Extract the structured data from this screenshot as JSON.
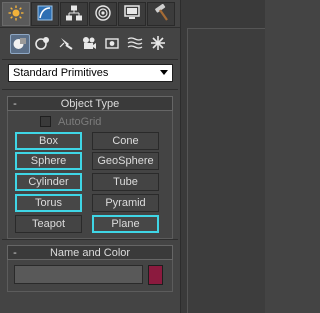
{
  "tabs": [
    {
      "icon": "create-sun-icon",
      "active": true
    },
    {
      "icon": "modify-curve-icon",
      "active": false
    },
    {
      "icon": "hierarchy-icon",
      "active": false
    },
    {
      "icon": "motion-icon",
      "active": false
    },
    {
      "icon": "display-icon",
      "active": false
    },
    {
      "icon": "utilities-hammer-icon",
      "active": false
    }
  ],
  "categories": [
    {
      "icon": "geometry-icon",
      "active": true
    },
    {
      "icon": "shapes-icon",
      "active": false
    },
    {
      "icon": "lights-icon",
      "active": false
    },
    {
      "icon": "cameras-icon",
      "active": false
    },
    {
      "icon": "helpers-icon",
      "active": false
    },
    {
      "icon": "space-warps-icon",
      "active": false
    },
    {
      "icon": "systems-icon",
      "active": false
    }
  ],
  "dropdown": {
    "value": "Standard Primitives"
  },
  "object_type": {
    "toggle": "-",
    "title": "Object Type",
    "autogrid_label": "AutoGrid",
    "buttons": [
      {
        "label": "Box",
        "selected": true
      },
      {
        "label": "Cone",
        "selected": false
      },
      {
        "label": "Sphere",
        "selected": true
      },
      {
        "label": "GeoSphere",
        "selected": false
      },
      {
        "label": "Cylinder",
        "selected": true
      },
      {
        "label": "Tube",
        "selected": false
      },
      {
        "label": "Torus",
        "selected": true
      },
      {
        "label": "Pyramid",
        "selected": false
      },
      {
        "label": "Teapot",
        "selected": false
      },
      {
        "label": "Plane",
        "selected": true
      }
    ]
  },
  "name_and_color": {
    "toggle": "-",
    "title": "Name and Color",
    "name_value": "",
    "color": "#8b1a3e"
  },
  "colors": {
    "selection_outline": "#3fd6e6",
    "active_category": "#5b6f88"
  }
}
